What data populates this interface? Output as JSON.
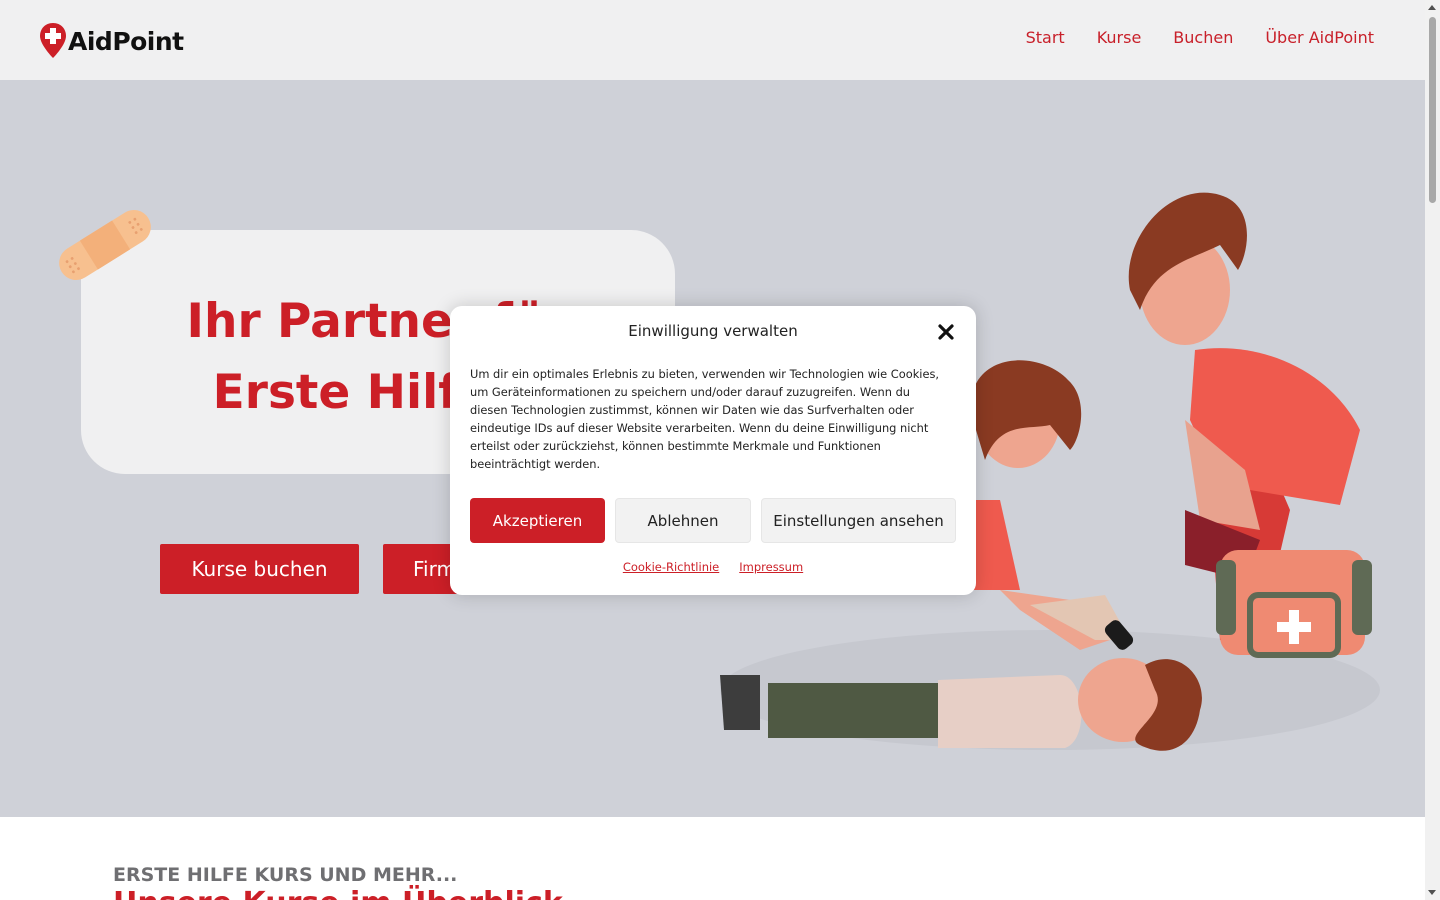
{
  "brand": {
    "name": "AidPoint",
    "accent": "#cc1f27"
  },
  "nav": {
    "items": [
      "Start",
      "Kurse",
      "Buchen",
      "Über AidPoint"
    ]
  },
  "hero": {
    "title_line1": "Ihr Partner für",
    "title_line2": "Erste Hilfe K",
    "buttons": {
      "kurse": "Kurse buchen",
      "firmen": "Firmen"
    }
  },
  "section": {
    "kicker": "ERSTE HILFE KURS UND MEHR...",
    "heading": "Unsere Kurse im Überblick"
  },
  "consent": {
    "title": "Einwilligung verwalten",
    "text": "Um dir ein optimales Erlebnis zu bieten, verwenden wir Technologien wie Cookies, um Geräteinformationen zu speichern und/oder darauf zuzugreifen. Wenn du diesen Technologien zustimmst, können wir Daten wie das Surfverhalten oder eindeutige IDs auf dieser Website verarbeiten. Wenn du deine Einwilligung nicht erteilst oder zurückziehst, können bestimmte Merkmale und Funktionen beeinträchtigt werden.",
    "accept": "Akzeptieren",
    "deny": "Ablehnen",
    "settings": "Einstellungen ansehen",
    "link_policy": "Cookie-Richtlinie",
    "link_imprint": "Impressum"
  },
  "icons": [
    "location-pin-cross-icon",
    "close-icon",
    "bandaid-icon"
  ]
}
